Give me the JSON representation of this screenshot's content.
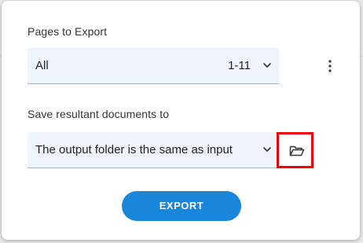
{
  "pages_section": {
    "label": "Pages to Export",
    "selected": "All",
    "range": "1-11"
  },
  "save_section": {
    "label": "Save resultant documents to",
    "selected": "The output folder is the same as input"
  },
  "export_button": {
    "label": "EXPORT"
  },
  "icons": {
    "more_menu": "more-vertical-icon",
    "folder": "folder-open-icon",
    "dropdown": "chevron-down-icon"
  },
  "colors": {
    "accent": "#1786db",
    "highlight": "#e8000b",
    "field_bg": "#eef4fb"
  }
}
